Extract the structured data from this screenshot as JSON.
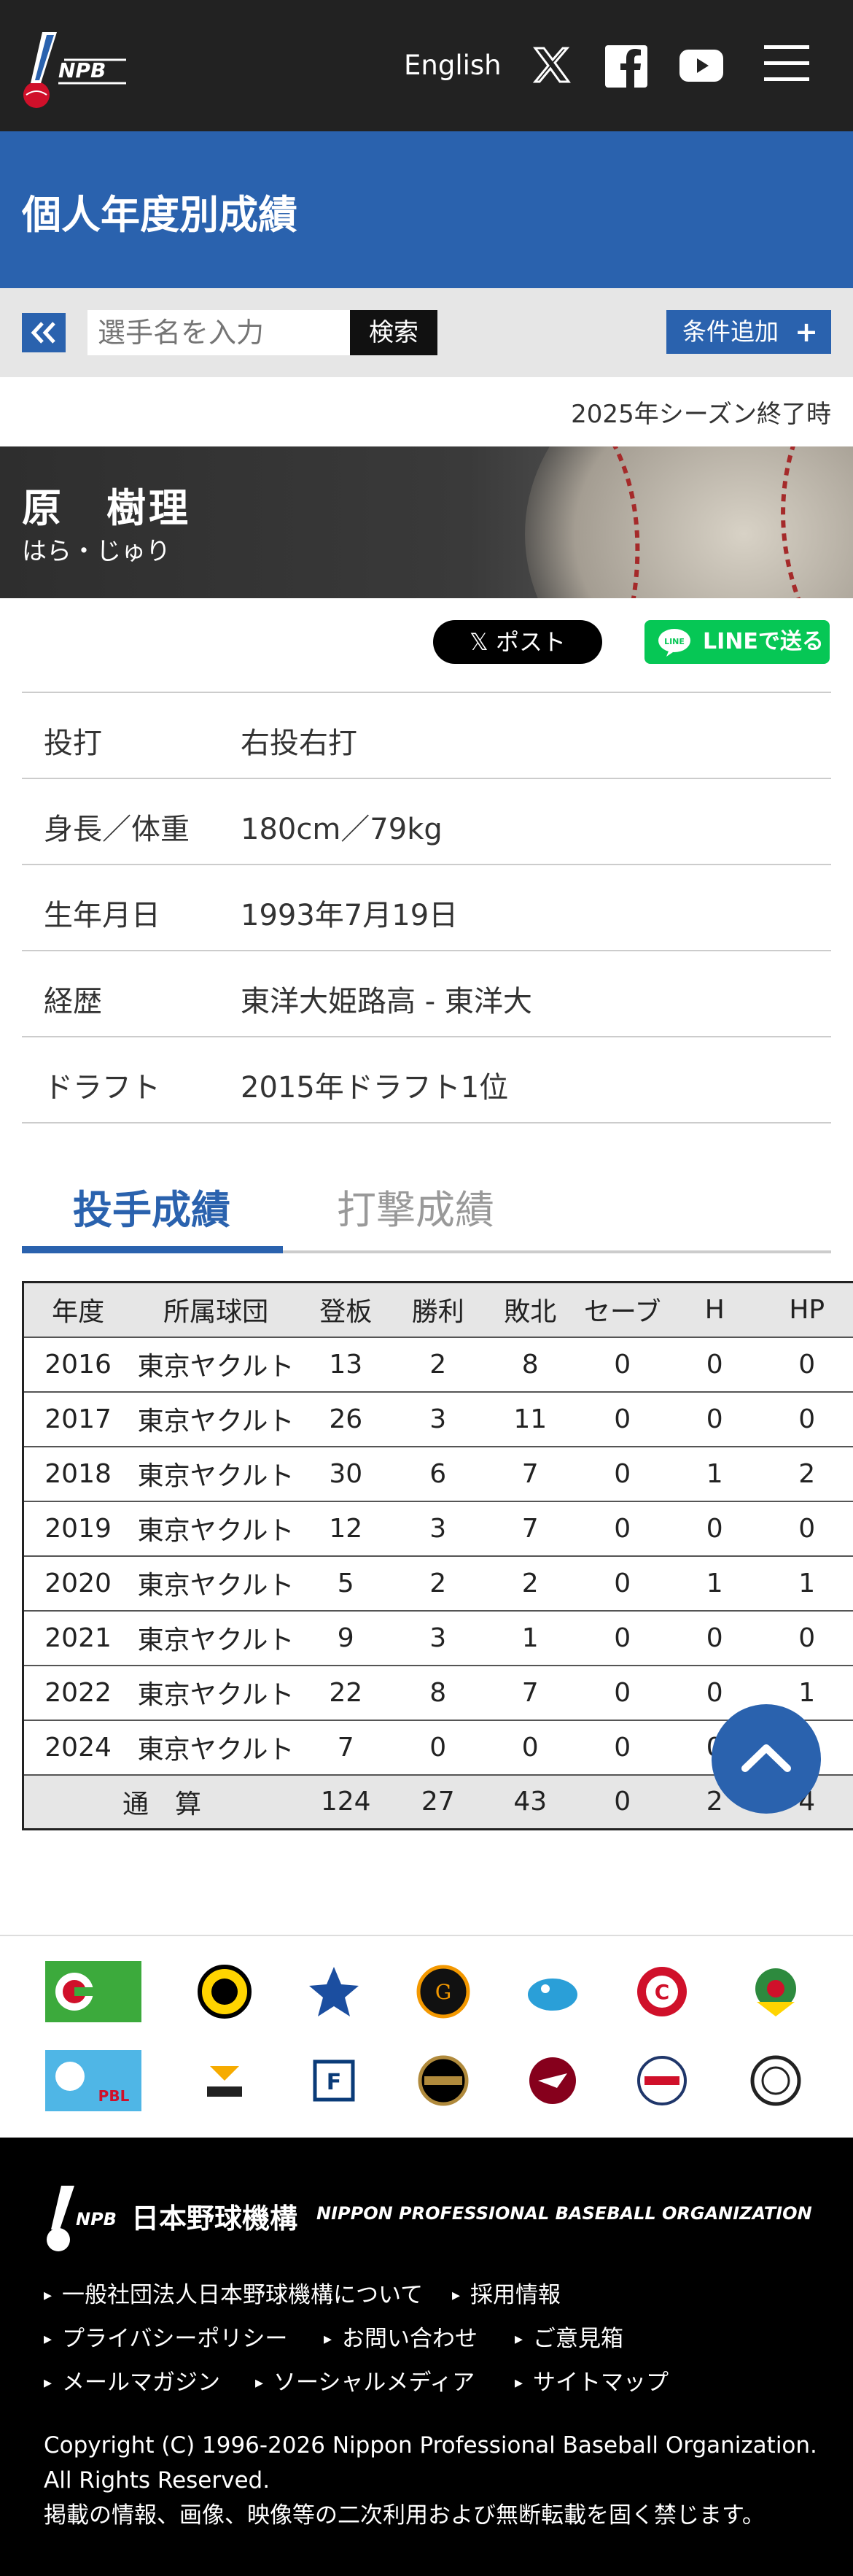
{
  "header": {
    "logo_text": "NPB",
    "lang_label": "English",
    "icons": [
      "x-icon",
      "facebook-icon",
      "youtube-icon",
      "menu-icon"
    ]
  },
  "page_title": "個人年度別成績",
  "search": {
    "placeholder": "選手名を入力",
    "button_label": "検索",
    "condition_label": "条件追加"
  },
  "season_status": "2025年シーズン終了時",
  "player": {
    "name": "原　樹理",
    "kana": "はら・じゅり"
  },
  "share": {
    "post_label": "ポスト",
    "line_label": "LINEで送る"
  },
  "profile": [
    {
      "key": "投打",
      "value": "右投右打"
    },
    {
      "key": "身長／体重",
      "value": "180cm／79kg"
    },
    {
      "key": "生年月日",
      "value": "1993年7月19日"
    },
    {
      "key": "経歴",
      "value": "東洋大姫路高 - 東洋大"
    },
    {
      "key": "ドラフト",
      "value": "2015年ドラフト1位"
    }
  ],
  "tabs": {
    "active": "投手成績",
    "inactive": "打撃成績"
  },
  "stats": {
    "headers": [
      "年度",
      "所属球団",
      "登板",
      "勝利",
      "敗北",
      "セーブ",
      "H",
      "HP"
    ],
    "rows": [
      [
        "2016",
        "東京ヤクルト",
        "13",
        "2",
        "8",
        "0",
        "0",
        "0"
      ],
      [
        "2017",
        "東京ヤクルト",
        "26",
        "3",
        "11",
        "0",
        "0",
        "0"
      ],
      [
        "2018",
        "東京ヤクルト",
        "30",
        "6",
        "7",
        "0",
        "1",
        "2"
      ],
      [
        "2019",
        "東京ヤクルト",
        "12",
        "3",
        "7",
        "0",
        "0",
        "0"
      ],
      [
        "2020",
        "東京ヤクルト",
        "5",
        "2",
        "2",
        "0",
        "1",
        "1"
      ],
      [
        "2021",
        "東京ヤクルト",
        "9",
        "3",
        "1",
        "0",
        "0",
        "0"
      ],
      [
        "2022",
        "東京ヤクルト",
        "22",
        "8",
        "7",
        "0",
        "0",
        "1"
      ],
      [
        "2024",
        "東京ヤクルト",
        "7",
        "0",
        "0",
        "0",
        "0",
        "0"
      ]
    ],
    "total": [
      "通　算",
      "124",
      "27",
      "43",
      "0",
      "2",
      "4"
    ]
  },
  "team_logos": {
    "row1": [
      "Central League",
      "Tigers",
      "BayStars",
      "Giants",
      "Dragons",
      "Carp",
      "Swallows"
    ],
    "row2": [
      "Pacific League",
      "Hawks",
      "Fighters",
      "Buffaloes",
      "Eagles",
      "Lions",
      "Marines"
    ]
  },
  "footer": {
    "org_name_jp": "日本野球機構",
    "org_name_en": "NIPPON PROFESSIONAL BASEBALL ORGANIZATION",
    "links": [
      [
        "一般社団法人日本野球機構について",
        "採用情報"
      ],
      [
        "プライバシーポリシー",
        "お問い合わせ",
        "ご意見箱"
      ],
      [
        "メールマガジン",
        "ソーシャルメディア",
        "サイトマップ"
      ]
    ],
    "copyright": "Copyright (C) 1996-2026 Nippon Professional Baseball Organization.",
    "rights": "All Rights Reserved.",
    "notice": "掲載の情報、画像、映像等の二次利用および無断転載を固く禁じます。"
  }
}
